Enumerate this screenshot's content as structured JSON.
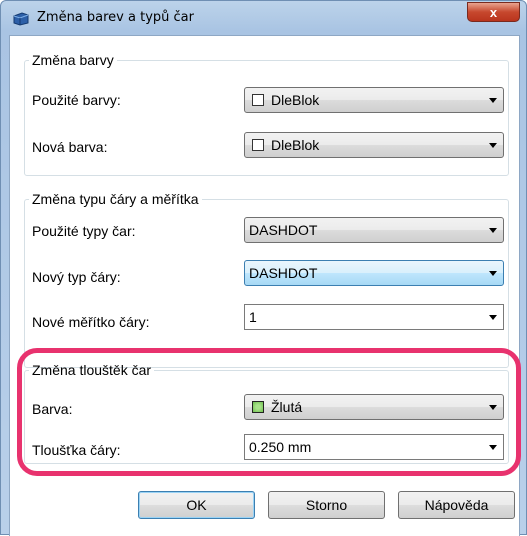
{
  "window": {
    "title": "Změna barev a typů čar",
    "close_label": "x"
  },
  "colors": {
    "highlight": "#e8326e",
    "yellow_swatch": "#8cd66a"
  },
  "group_color": {
    "legend": "Změna barvy",
    "used_label": "Použité barvy:",
    "used_value": "DleBlok",
    "new_label": "Nová barva:",
    "new_value": "DleBlok"
  },
  "group_linetype": {
    "legend": "Změna typu čáry a měřítka",
    "used_label": "Použité typy čar:",
    "used_value": "DASHDOT",
    "new_label": "Nový typ čáry:",
    "new_value": "DASHDOT",
    "scale_label": "Nové měřítko čáry:",
    "scale_value": "1"
  },
  "group_lineweight": {
    "legend": "Změna tlouštěk čar",
    "color_label": "Barva:",
    "color_value": "Žlutá",
    "weight_label": "Tloušťka čáry:",
    "weight_value": "0.250 mm"
  },
  "buttons": {
    "ok": "OK",
    "cancel": "Storno",
    "help": "Nápověda"
  }
}
